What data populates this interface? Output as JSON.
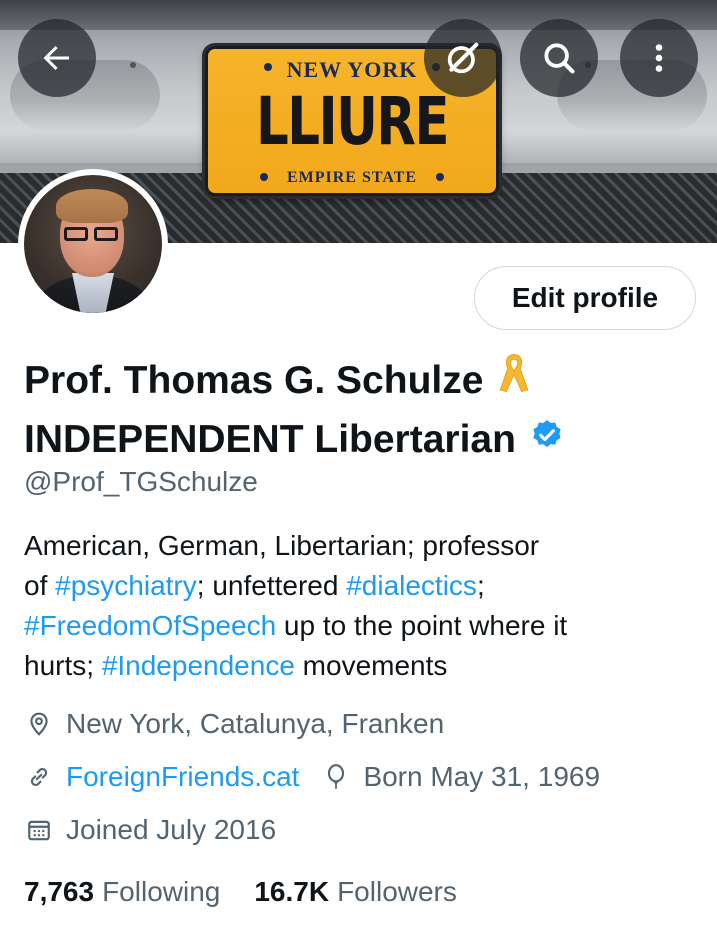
{
  "banner": {
    "plate_state": "NEW YORK",
    "plate_number": "LLIURE",
    "plate_bottom": "EMPIRE STATE",
    "buttons": {
      "back_icon": "arrow-left-icon",
      "grok_icon": "grok-icon",
      "search_icon": "search-icon",
      "more_icon": "more-vertical-icon"
    }
  },
  "profile": {
    "edit_button_label": "Edit profile",
    "name_line1": "Prof. Thomas G. Schulze",
    "name_line2": "INDEPENDENT Libertarian",
    "handle": "@Prof_TGSchulze",
    "bio": {
      "line1": "American, German, Libertarian; professor",
      "line2_pre": "of ",
      "line2_tag1": "#psychiatry",
      "line2_mid": "; unfettered ",
      "line2_tag2": "#dialectics",
      "line2_post": ";",
      "line3_tag": "#FreedomOfSpeech",
      "line3_post": " up to the point where it",
      "line4_pre": "hurts; ",
      "line4_tag": "#Independence",
      "line4_post": " movements"
    },
    "location": "New York, Catalunya, Franken",
    "website": "ForeignFriends.cat",
    "birthday": "Born May 31, 1969",
    "joined": "Joined July 2016",
    "following_count": "7,763",
    "following_label": "Following",
    "followers_count": "16.7K",
    "followers_label": "Followers"
  },
  "colors": {
    "accent": "#1d9bf0",
    "ribbon": "#f5b82e",
    "secondary_text": "#536471",
    "primary_text": "#0f1419"
  }
}
